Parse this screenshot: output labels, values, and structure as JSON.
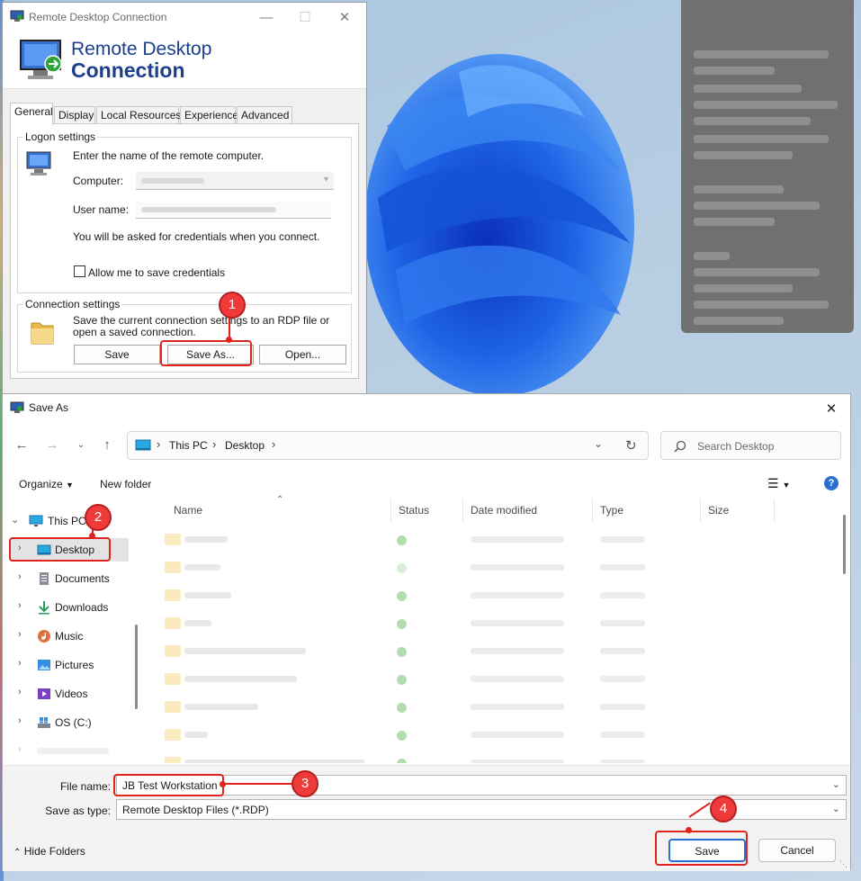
{
  "rdp": {
    "window_title": "Remote Desktop Connection",
    "banner_line1": "Remote Desktop",
    "banner_line2": "Connection",
    "tabs": [
      {
        "label": "General"
      },
      {
        "label": "Display"
      },
      {
        "label": "Local Resources"
      },
      {
        "label": "Experience"
      },
      {
        "label": "Advanced"
      }
    ],
    "logon": {
      "legend": "Logon settings",
      "instruction": "Enter the name of the remote computer.",
      "computer_label": "Computer:",
      "user_label": "User name:",
      "credentials_note": "You will be asked for credentials when you connect.",
      "allow_save_label": "Allow me to save credentials",
      "allow_save_checked": false
    },
    "connection": {
      "legend": "Connection settings",
      "description": "Save the current connection settings to an RDP file or open a saved connection.",
      "save_label": "Save",
      "save_as_label": "Save As...",
      "open_label": "Open..."
    }
  },
  "saveas": {
    "title": "Save As",
    "breadcrumb": [
      "This PC",
      "Desktop"
    ],
    "search_placeholder": "Search Desktop",
    "organize_label": "Organize",
    "new_folder_label": "New folder",
    "sidebar": [
      {
        "label": "This PC",
        "icon": "monitor-icon"
      },
      {
        "label": "Desktop",
        "icon": "desktop-folder-icon"
      },
      {
        "label": "Documents",
        "icon": "documents-icon"
      },
      {
        "label": "Downloads",
        "icon": "download-icon"
      },
      {
        "label": "Music",
        "icon": "music-icon"
      },
      {
        "label": "Pictures",
        "icon": "pictures-icon"
      },
      {
        "label": "Videos",
        "icon": "videos-icon"
      },
      {
        "label": "OS (C:)",
        "icon": "drive-icon"
      }
    ],
    "columns": [
      "Name",
      "Status",
      "Date modified",
      "Type",
      "Size"
    ],
    "file_name_label": "File name:",
    "file_name_value": "JB Test Workstation",
    "save_type_label": "Save as type:",
    "save_type_value": "Remote Desktop Files (*.RDP)",
    "hide_folders_label": "Hide Folders",
    "save_label": "Save",
    "cancel_label": "Cancel"
  },
  "callouts": [
    "1",
    "2",
    "3",
    "4"
  ],
  "colors": {
    "accent": "#2a6fd1",
    "callout": "#ef3a3a",
    "banner_text": "#1a3f8f"
  }
}
